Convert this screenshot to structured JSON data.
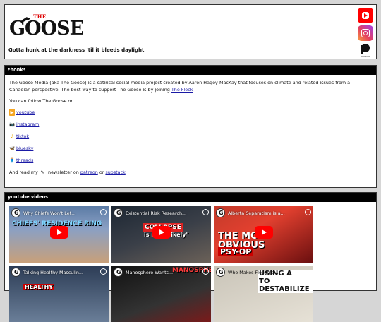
{
  "header": {
    "logo_small": "THE",
    "logo_word": "GOOSE",
    "tagline": "Gotta honk at the darkness 'til it bleeds daylight",
    "social": [
      {
        "name": "youtube-icon",
        "color": "#ff0000"
      },
      {
        "name": "instagram-icon",
        "color": "#e4405f"
      },
      {
        "name": "patreon-icon",
        "color": "#111111"
      }
    ],
    "patreon_label": "PATREON"
  },
  "honk": {
    "title": "*honk*",
    "intro_1": "The Goose Media (aka The Goose) is a satirical social media project created by Aaron Hagey-MacKay that focuses on climate and related issues from a Canadian perspective. The best way to support The Goose is by joining",
    "flock_link": "The Flock",
    "follow_text": "You can follow The Goose on...",
    "follow": [
      {
        "emoji": "▶",
        "label": "youtube"
      },
      {
        "emoji": "📷",
        "label": "instagram"
      },
      {
        "emoji": "♪",
        "label": "tiktok"
      },
      {
        "emoji": "🦋",
        "label": "bluesky"
      },
      {
        "emoji": "🧵",
        "label": "threads"
      }
    ],
    "newsletter_prefix": "And read my",
    "newsletter_mid": "newsletter on",
    "patreon_link": "patreon",
    "or_text": "or",
    "substack_link": "substack"
  },
  "videos": {
    "title": "youtube videos",
    "items": [
      {
        "title": "Why Chiefs Won't Let...",
        "overlay": "CHIEFS' RESIDENCE RING"
      },
      {
        "title": "Existential Risk Research...",
        "overlay_1": "COLLAPSE",
        "overlay_2": "is most likely\""
      },
      {
        "title": "Alberta Separatism is a...",
        "overlay_1": "THE MOST OBVIOUS",
        "overlay_2": "PSY-OP"
      },
      {
        "title": "Talking Healthy Masculin...",
        "overlay": "HEALTHY"
      },
      {
        "title": "Manosphere Wants...",
        "overlay": "MANOSPHERE"
      },
      {
        "title": "Who Makes Flooding...",
        "overlay_1": "USING A",
        "overlay_2": "TO DESTABILIZE"
      }
    ]
  }
}
